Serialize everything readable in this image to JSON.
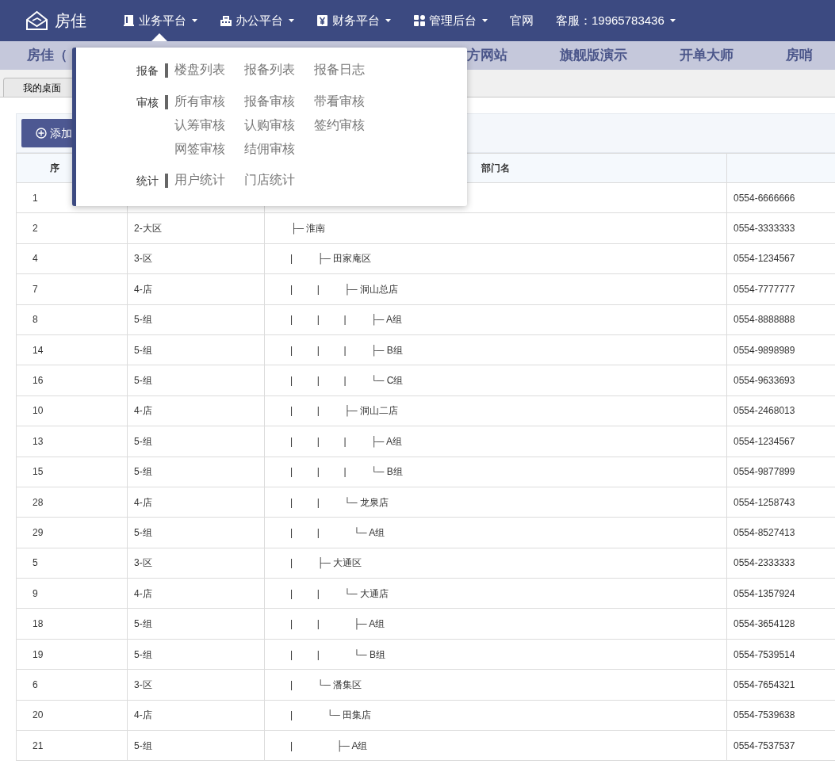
{
  "brand": {
    "name": "房佳"
  },
  "nav": [
    {
      "label": "业务平台",
      "kind": "menu",
      "expanded": true
    },
    {
      "label": "办公平台",
      "kind": "menu",
      "expanded": false
    },
    {
      "label": "财务平台",
      "kind": "menu",
      "expanded": false
    },
    {
      "label": "管理后台",
      "kind": "menu",
      "expanded": false
    },
    {
      "label": "官网",
      "kind": "link"
    },
    {
      "label": "客服：19965783436",
      "kind": "plain-menu",
      "expanded": false
    }
  ],
  "banner": [
    "房佳（",
    "方网站",
    "旗舰版演示",
    "开单大师",
    "房哨"
  ],
  "tabs": [
    {
      "label": "我的桌面",
      "selected": true
    }
  ],
  "dropdown": [
    {
      "label": "报备",
      "items": [
        "楼盘列表",
        "报备列表",
        "报备日志"
      ]
    },
    {
      "label": "审核",
      "items": [
        "所有审核",
        "报备审核",
        "带看审核",
        "认筹审核",
        "认购审核",
        "签约审核",
        "网签审核",
        "结佣审核"
      ]
    },
    {
      "label": "统计",
      "items": [
        "用户统计",
        "门店统计"
      ]
    }
  ],
  "add_button": "添加",
  "table": {
    "columns": [
      {
        "label": "序"
      },
      {
        "label": "部门名"
      }
    ],
    "rows": [
      [
        "1",
        "",
        "",
        "0554-6666666"
      ],
      [
        "2",
        "2-大区",
        "├─ 淮南",
        "0554-3333333"
      ],
      [
        "4",
        "3-区",
        "|　　  ├─ 田家庵区",
        "0554-1234567"
      ],
      [
        "7",
        "4-店",
        "|　　  |　　  ├─ 洞山总店",
        "0554-7777777"
      ],
      [
        "8",
        "5-组",
        "|　　  |　　  |　　  ├─ A组",
        "0554-8888888"
      ],
      [
        "14",
        "5-组",
        "|　　  |　　  |　　  ├─ B组",
        "0554-9898989"
      ],
      [
        "16",
        "5-组",
        "|　　  |　　  |　　  └─ C组",
        "0554-9633693"
      ],
      [
        "10",
        "4-店",
        "|　　  |　　  ├─ 洞山二店",
        "0554-2468013"
      ],
      [
        "13",
        "5-组",
        "|　　  |　　  |　　  ├─ A组",
        "0554-1234567"
      ],
      [
        "15",
        "5-组",
        "|　　  |　　  |　　  └─ B组",
        "0554-9877899"
      ],
      [
        "28",
        "4-店",
        "|　　  |　　  └─ 龙泉店",
        "0554-1258743"
      ],
      [
        "29",
        "5-组",
        "|　　  |　　  　└─ A组",
        "0554-8527413"
      ],
      [
        "5",
        "3-区",
        "|　　  ├─ 大通区",
        "0554-2333333"
      ],
      [
        "9",
        "4-店",
        "|　　  |　　  └─ 大通店",
        "0554-1357924"
      ],
      [
        "18",
        "5-组",
        "|　　  |　　  　├─ A组",
        "0554-3654128"
      ],
      [
        "19",
        "5-组",
        "|　　  |　　  　└─ B组",
        "0554-7539514"
      ],
      [
        "6",
        "3-区",
        "|　　  └─ 潘集区",
        "0554-7654321"
      ],
      [
        "20",
        "4-店",
        "|　　  　└─ 田集店",
        "0554-7539638"
      ],
      [
        "21",
        "5-组",
        "|　　  　　├─ A组",
        "0554-7537537"
      ]
    ]
  }
}
